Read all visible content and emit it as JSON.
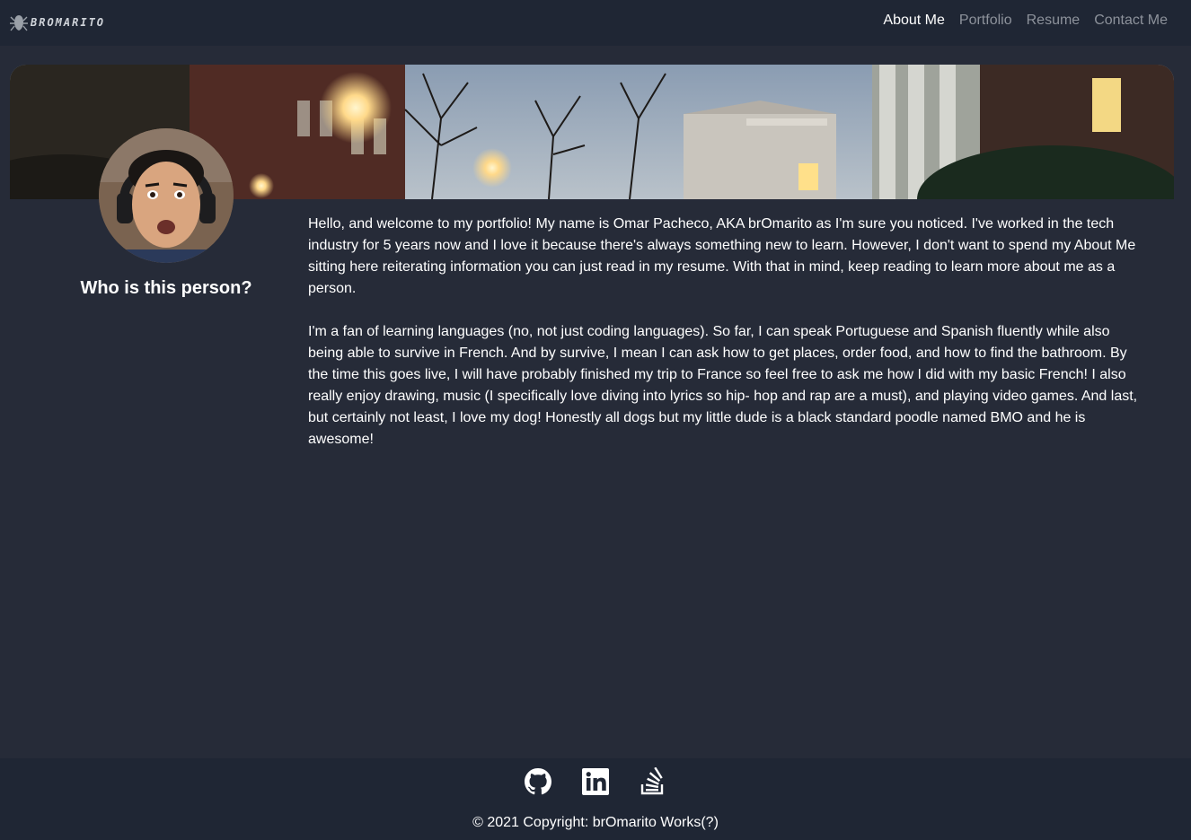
{
  "brand": {
    "logo_text": "BROMARITO",
    "logo_icon": "spider-logo-icon"
  },
  "nav": {
    "items": [
      {
        "label": "About Me",
        "active": true
      },
      {
        "label": "Portfolio",
        "active": false
      },
      {
        "label": "Resume",
        "active": false
      },
      {
        "label": "Contact Me",
        "active": false
      }
    ]
  },
  "profile": {
    "heading": "Who is this person?"
  },
  "about": {
    "paragraphs": [
      "Hello, and welcome to my portfolio! My name is Omar Pacheco, AKA brOmarito as I'm sure you noticed. I've worked in the tech industry for 5 years now and I love it because there's always something new to learn. However, I don't want to spend my About Me sitting here reiterating information you can just read in my resume. With that in mind, keep reading to learn more about me as a person.",
      "I'm a fan of learning languages (no, not just coding languages). So far, I can speak Portuguese and Spanish fluently while also being able to survive in French. And by survive, I mean I can ask how to get places, order food, and how to find the bathroom. By the time this goes live, I will have probably finished my trip to France so feel free to ask me how I did with my basic French! I also really enjoy drawing, music (I specifically love diving into lyrics so hip- hop and rap are a must), and playing video games. And last, but certainly not least, I love my dog! Honestly all dogs but my little dude is a black standard poodle named BMO and he is awesome!"
    ]
  },
  "footer": {
    "social_icons": [
      "github-icon",
      "linkedin-icon",
      "stackoverflow-icon"
    ],
    "copyright": "© 2021 Copyright: brOmarito Works(?)"
  },
  "colors": {
    "background": "#262b38",
    "navbar": "#1f2634",
    "active_link": "#ffffff",
    "inactive_link": "#8d929b"
  }
}
